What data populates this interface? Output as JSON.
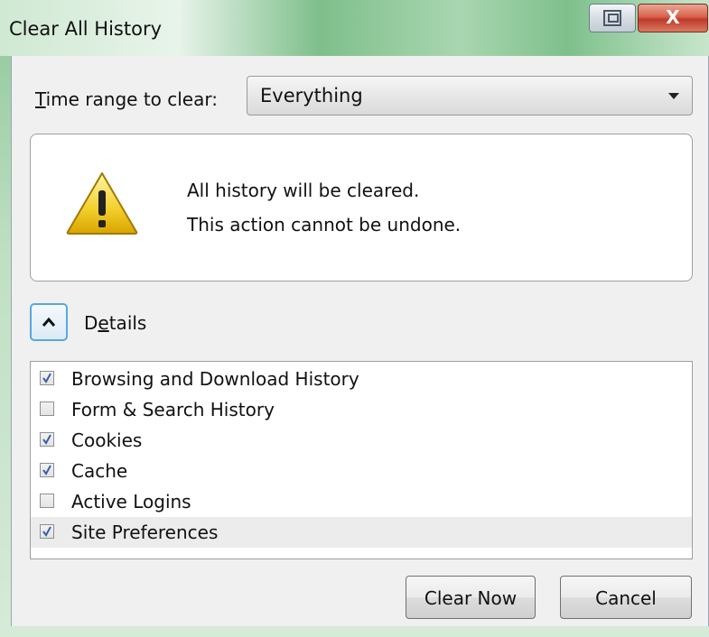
{
  "window": {
    "title": "Clear All History",
    "close_label": "X"
  },
  "time_range": {
    "label_underlined": "T",
    "label_rest": "ime range to clear:",
    "selected": "Everything"
  },
  "warning": {
    "line1": "All history will be cleared.",
    "line2": "This action cannot be undone."
  },
  "details": {
    "label_pre": "D",
    "label_underlined": "e",
    "label_post": "tails"
  },
  "items": [
    {
      "label": "Browsing and Download History",
      "checked": true
    },
    {
      "label": "Form & Search History",
      "checked": false
    },
    {
      "label": "Cookies",
      "checked": true
    },
    {
      "label": "Cache",
      "checked": true
    },
    {
      "label": "Active Logins",
      "checked": false
    },
    {
      "label": "Site Preferences",
      "checked": true
    }
  ],
  "buttons": {
    "clear_now": "Clear Now",
    "cancel": "Cancel"
  },
  "icons": {
    "warning": "warning-icon",
    "restore": "restore-icon",
    "chevron": "chevron-up-icon"
  }
}
